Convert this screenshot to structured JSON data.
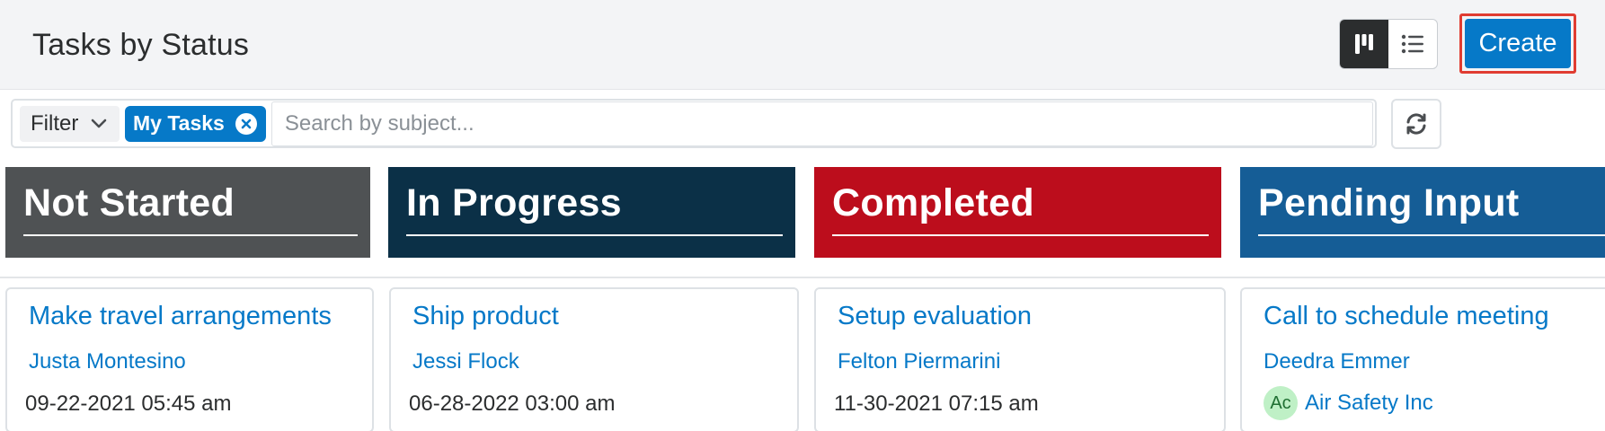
{
  "header": {
    "title": "Tasks by Status",
    "view_toggle": {
      "active": "tile-view",
      "icons": [
        "tile-view-icon",
        "list-view-icon"
      ]
    },
    "create_label": "Create"
  },
  "filter": {
    "dropdown_label": "Filter",
    "active_filter": "My Tasks",
    "search_placeholder": "Search by subject...",
    "search_value": ""
  },
  "columns": [
    {
      "title": "Not Started",
      "color": "#4f5254",
      "cards": [
        {
          "subject": "Make travel arrangements",
          "assignee": "Justa Montesino",
          "date": "09-22-2021 05:45 am"
        }
      ]
    },
    {
      "title": "In Progress",
      "color": "#0b3047",
      "cards": [
        {
          "subject": "Ship product",
          "assignee": "Jessi Flock",
          "date": "06-28-2022 03:00 am"
        }
      ]
    },
    {
      "title": "Completed",
      "color": "#bc0d1c",
      "cards": [
        {
          "subject": "Setup evaluation",
          "assignee": "Felton Piermarini",
          "date": "11-30-2021 07:15 am"
        }
      ]
    },
    {
      "title": "Pending Input",
      "color": "#155d96",
      "cards": [
        {
          "subject": "Call to schedule meeting",
          "assignee": "Deedra Emmer",
          "account_badge": "Ac",
          "account": "Air Safety Inc"
        }
      ]
    }
  ],
  "colors": {
    "accent": "#0679c8",
    "highlight_border": "#e03c31"
  }
}
